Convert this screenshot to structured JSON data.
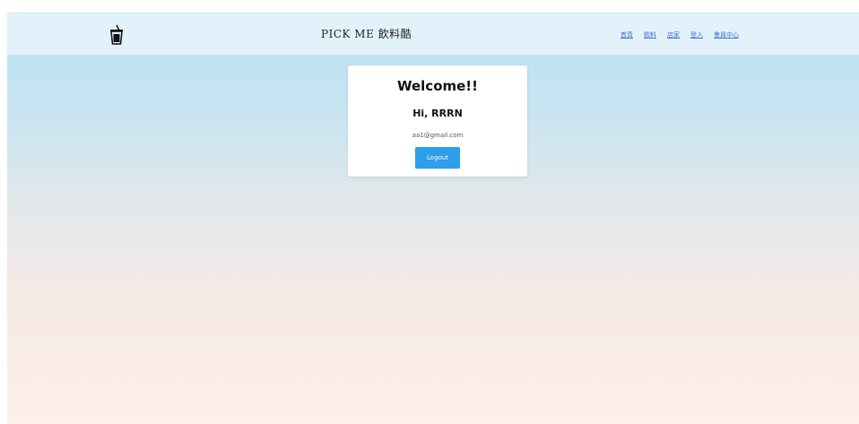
{
  "header": {
    "logo_icon": "cup-drink-icon",
    "brand": "PICK ME 飲料酷",
    "nav_links": [
      "首頁",
      "飲料",
      "店家",
      "登入",
      "會員中心"
    ]
  },
  "profile_card": {
    "title": "Welcome!!",
    "greeting": "Hi, RRRN",
    "email": "aa1@gmail.com",
    "logout_label": "Logout"
  },
  "colors": {
    "accent": "#2d9ee8",
    "nav_background": "#e3f2fa",
    "gradient_top": "#b9e2f5",
    "gradient_bottom": "#fdefe9",
    "link": "#3a6fd6"
  }
}
